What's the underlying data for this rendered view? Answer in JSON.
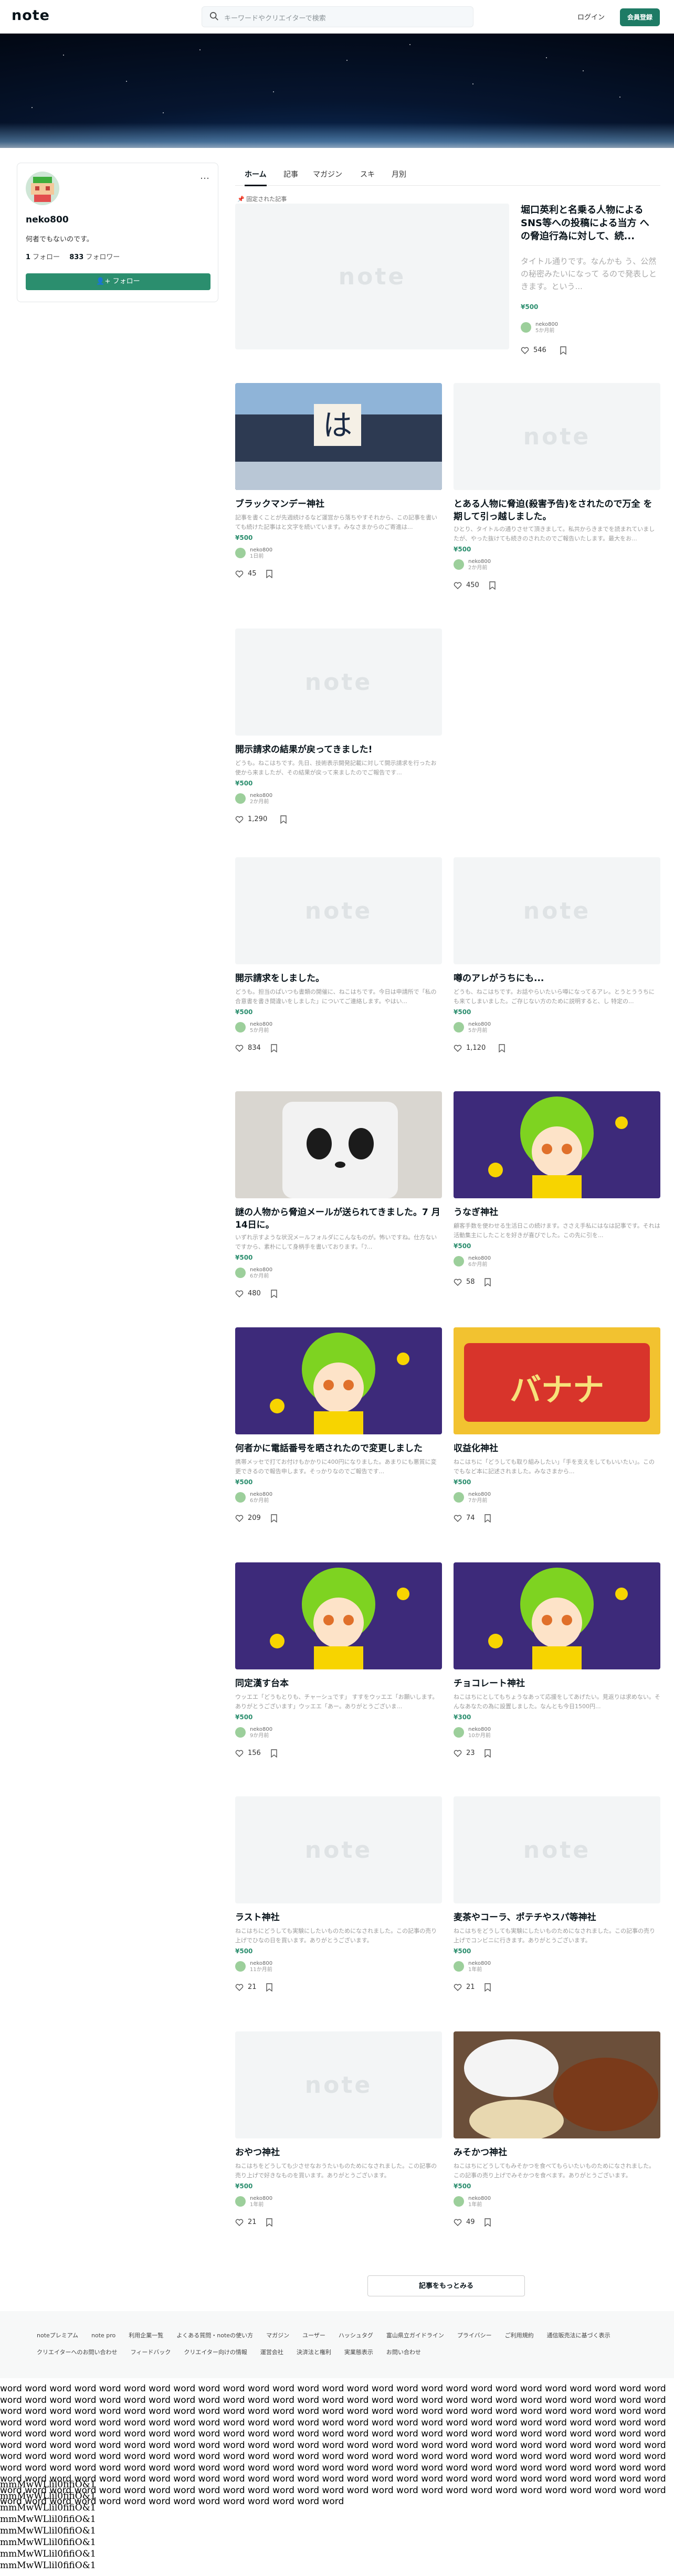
{
  "header": {
    "logo": "note",
    "search_placeholder": "キーワードやクリエイターで検索",
    "login": "ログイン",
    "signup": "会員登録"
  },
  "profile": {
    "name": "neko800",
    "bio": "何者でもないのです。",
    "following_count": "1",
    "following_label": "フォロー",
    "followers_count": "833",
    "followers_label": "フォロワー",
    "follow_button": "フォロー",
    "more": "…"
  },
  "tabs": [
    "ホーム",
    "記事",
    "マガジン",
    "スキ",
    "月別"
  ],
  "pinned_label": "固定された記事",
  "featured": {
    "title": "堀口英利と名乗る人物による SNS等への投稿による当方 への脅迫行為に対して、続...",
    "excerpt": "タイトル通りです。なんかも う、公然の秘密みたいになって るので発表しときます。という...",
    "price": "¥500",
    "author": "neko800",
    "time": "5か月前",
    "likes": "546"
  },
  "articles": [
    {
      "title": "ブラックマンデー神社",
      "excerpt": "記事を書くことが先週続けるなど運営から落ちやすそれから、この記事を書いても続けた記事はと文字を続いています。みなさまからのご寄進は...",
      "price": "¥500",
      "author": "neko800",
      "time": "1日前",
      "likes": "45"
    },
    {
      "title": "とある人物に脅迫(殺害予告)をされたので万全 を期して引っ越しました。",
      "excerpt": "ひとり、タイトルの通りさせて頂きまして。私共からきまでを読まれていましたが、やった抜けても続きのされたのでご報告いたします。最大をお...",
      "price": "¥500",
      "author": "neko800",
      "time": "2か月前",
      "likes": "450"
    },
    {
      "title": "開示請求の結果が戻ってきました!",
      "excerpt": "どうも。ねこはちです。先日、技術表示開発記載に対して開示請求を行ったお使から来ましたが、その結果が戻って来ましたのでご報告です...",
      "price": "¥500",
      "author": "neko800",
      "time": "2か月前",
      "likes": "1,290"
    },
    {
      "title": "開示請求をしました。",
      "excerpt": "どうも。担当のぱいつも書類の開催に、ねこはちです。今日は申請所で「私の合意書を書き間違いをしました」についてご連絡します。やはい...",
      "price": "¥500",
      "author": "neko800",
      "time": "5か月前",
      "likes": "834"
    },
    {
      "title": "噂のアレがうちにも...",
      "excerpt": "どうも、ねこはちです。お話やらいたいら噂になってるアレ。とうとううちにも来てしまいました。ご存じない方のために説明すると、し 特定の...",
      "price": "¥500",
      "author": "neko800",
      "time": "5か月前",
      "likes": "1,120"
    },
    {
      "title": "謎の人物から脅迫メールが送られてきました。7 月14日に。",
      "excerpt": "いずれ示すような状況メールフォルダにこんなものが。怖いですね。仕方ないですから、素朴にして身柄手を書いております。「ﾌ...",
      "price": "¥500",
      "author": "neko800",
      "time": "6か月前",
      "likes": "480"
    },
    {
      "title": "うなぎ神社",
      "excerpt": "顧客手数を使わせる生活日この続けます。ささえ手私にはなは記事です。それは活動集主にしたことを好きが喜びでした。この先に引を...",
      "price": "¥500",
      "author": "neko800",
      "time": "6か月前",
      "likes": "58"
    },
    {
      "title": "何者かに電話番号を晒されたので変更しました",
      "excerpt": "携帯メッセで打てお付けもかかりに400円になりました。あまりにも悪質に変更できるので報告申します。そっかりなのでご報告です...",
      "price": "¥500",
      "author": "neko800",
      "time": "6か月前",
      "likes": "209"
    },
    {
      "title": "収益化神社",
      "excerpt": "ねこはちに「どうしても取り組みしたい」「手を支えをしてもいいたい」。このでもなど本に記述されました。みなさまから...",
      "price": "¥500",
      "author": "neko800",
      "time": "7か月前",
      "likes": "74"
    },
    {
      "title": "同定漢す台本",
      "excerpt": "ウッエエ「どうもとりも、チャーシュです」 すすをウッエエ「お願いします。ありがとうございます」ウッエエ「あー。ありがとうございま...",
      "price": "¥500",
      "author": "neko800",
      "time": "9か月前",
      "likes": "156"
    },
    {
      "title": "チョコレート神社",
      "excerpt": "ねこはちにとしてもちょうなあって応援をしてあげたい。見返りは求めない。そんなあなたの為に設置しました。なんとも今日1500円...",
      "price": "¥300",
      "author": "neko800",
      "time": "10か月前",
      "likes": "23"
    },
    {
      "title": "ラスト神社",
      "excerpt": "ねこはちにどうしても実験にしたいものためになされました。この記事の売り上げでひなの日を買います。ありがとうございます。",
      "price": "¥500",
      "author": "neko800",
      "time": "11か月前",
      "likes": "21"
    },
    {
      "title": "麦茶やコーラ、ポテチやスパ等神社",
      "excerpt": "ねこはちをどうしても実験にしたいものためになされました。この記事の売り上げでコンビニに行きます。ありがとうございます。",
      "price": "¥500",
      "author": "neko800",
      "time": "1年前",
      "likes": "21"
    },
    {
      "title": "おやつ神社",
      "excerpt": "ねこはちをどうしても少させなおうたいものためになされました。この記事の売り上げで好きなものを買います。ありがとうございます。",
      "price": "¥500",
      "author": "neko800",
      "time": "1年前",
      "likes": "21"
    },
    {
      "title": "みそかつ神社",
      "excerpt": "ねこはちにどうしてもみそかつを食べてもらいたいものためになされました。この記事の売り上げでみそかつを食べます。ありがとうございます。",
      "price": "¥500",
      "author": "neko800",
      "time": "1年前",
      "likes": "49"
    }
  ],
  "more_button": "記事をもっとみる",
  "footer_links": [
    "noteプレミアム",
    "note pro",
    "利用企業一覧",
    "よくある質問・noteの使い方",
    "マガジン",
    "ユーザー",
    "ハッシュタグ",
    "富山県立ガイドライン",
    "プライバシー",
    "ご利用規約",
    "通信販売法に基づく表示",
    "クリエイターへのお問い合わせ",
    "フィードバック",
    "クリエイター向けの情報",
    "運営会社",
    "決済法と権利",
    "実業態表示",
    "お問い合わせ"
  ],
  "body_words": "word word word word word word word word word word word word word word word word word word word word word word word word word word word word word word word word word word word word word word word word word word word word word word word word word word word word word word word word word word word word word word word word word word word word word word word word word word word word word word word word word word word word word word word word word word word word word word word word word word word word word word word word word word word word word word word word word word word word word word word word word word word word word word word word word word word word word word word word word word word word word word word word word word word word word word word word word word word word word word word word word word word word word word word word word word word word word word word word word word word word word word word word word word word word word word word word word word word word word word word word word word word word word word word word word word word word word word word word word word word word word word word word word word word word word word word word word word word word word word word word word word word word word word word word word word word word word word word word word word word word word word word word word word word word word word word word word word word word word word word word word word word word",
  "m_lines": [
    "mmMwWLlil0fifiO&1",
    "mmMwWLlil0fifiO&1",
    "mmMwWLlil0fifiO&1",
    "mmMwWLlil0fifiO&1",
    "mmMwWLlil0fifiO&1",
    "mmMwWLlil0fifiO&1",
    "mmMwWLlil0fifiO&1",
    "mmMwWLlil0fifiO&1"
  ]
}
